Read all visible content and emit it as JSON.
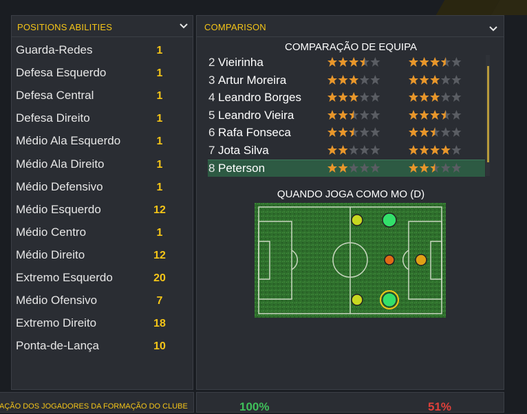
{
  "positions_panel": {
    "title": "POSITIONS ABILITIES",
    "rows": [
      {
        "label": "Guarda-Redes",
        "value": "1"
      },
      {
        "label": "Defesa Esquerdo",
        "value": "1"
      },
      {
        "label": "Defesa Central",
        "value": "1"
      },
      {
        "label": "Defesa Direito",
        "value": "1"
      },
      {
        "label": "Médio Ala Esquerdo",
        "value": "1"
      },
      {
        "label": "Médio Ala Direito",
        "value": "1"
      },
      {
        "label": "Médio Defensivo",
        "value": "1"
      },
      {
        "label": "Médio Esquerdo",
        "value": "12"
      },
      {
        "label": "Médio Centro",
        "value": "1"
      },
      {
        "label": "Médio Direito",
        "value": "12"
      },
      {
        "label": "Extremo Esquerdo",
        "value": "20"
      },
      {
        "label": "Médio Ofensivo",
        "value": "7"
      },
      {
        "label": "Extremo Direito",
        "value": "18"
      },
      {
        "label": "Ponta-de-Lança",
        "value": "10"
      }
    ]
  },
  "comparison_panel": {
    "title": "COMPARISON",
    "heading": "COMPARAÇÃO DE EQUIPA",
    "players": [
      {
        "num": "2",
        "name": "Vieirinha",
        "current_stars": 3.5,
        "potential_stars": 3.5
      },
      {
        "num": "3",
        "name": "Artur Moreira",
        "current_stars": 3,
        "potential_stars": 3
      },
      {
        "num": "4",
        "name": "Leandro Borges",
        "current_stars": 3,
        "potential_stars": 3
      },
      {
        "num": "5",
        "name": "Leandro Vieira",
        "current_stars": 2.5,
        "potential_stars": 3.5
      },
      {
        "num": "6",
        "name": "Rafa Fonseca",
        "current_stars": 2.5,
        "potential_stars": 2.5
      },
      {
        "num": "7",
        "name": "Jota Silva",
        "current_stars": 2,
        "potential_stars": 4
      },
      {
        "num": "8",
        "name": "Peterson",
        "current_stars": 2,
        "potential_stars": 2.5,
        "selected": true
      }
    ],
    "pitch_heading": "QUANDO JOGA COMO MO (D)"
  },
  "bottom": {
    "left_text": "AÇÃO DOS JOGADORES DA FORMAÇÃO DO CLUBE",
    "pct_left": "100%",
    "pct_right": "51%"
  },
  "colors": {
    "accent": "#f5c518",
    "star": "#e8962a",
    "selected_row": "#2d5a43",
    "pct_left": "#3fbf5a",
    "pct_right": "#e0403a"
  }
}
